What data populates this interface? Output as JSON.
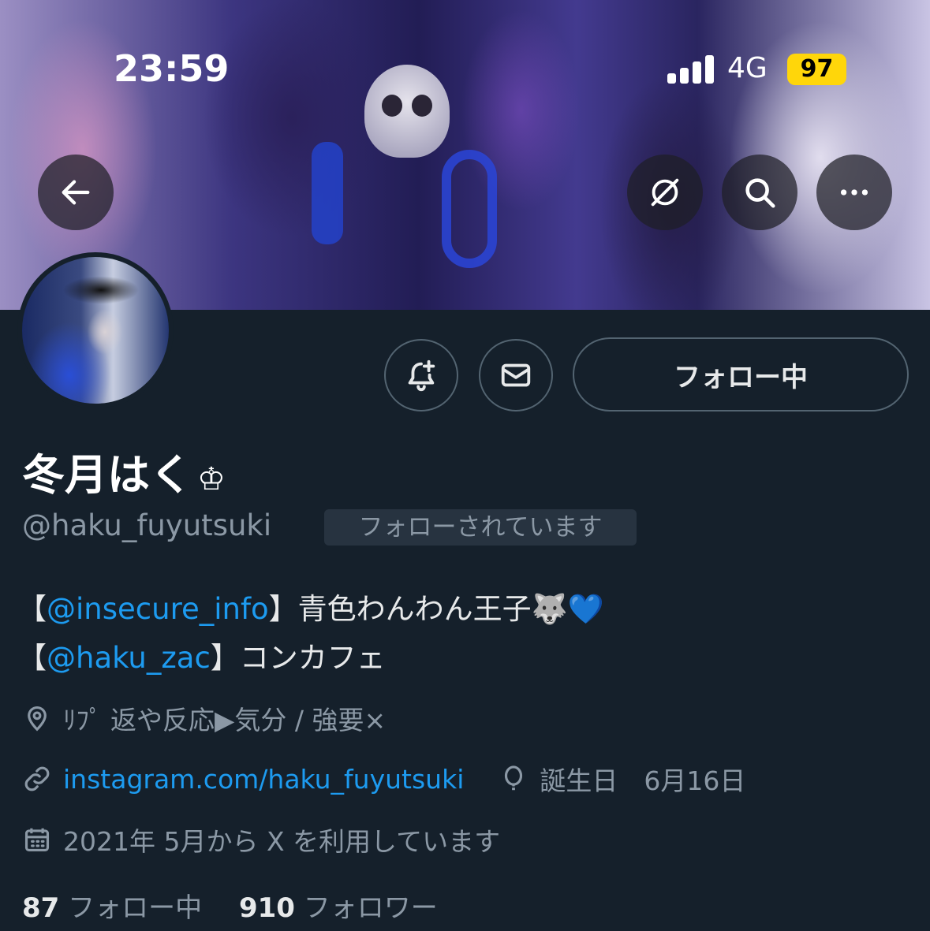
{
  "status_bar": {
    "time": "23:59",
    "network": "4G",
    "battery": "97"
  },
  "header": {
    "icons": [
      "back-arrow-icon",
      "no-grok-icon",
      "search-icon",
      "more-icon"
    ]
  },
  "actions": {
    "follow_label": "フォロー中",
    "icons": [
      "notification-bell-plus-icon",
      "mail-icon"
    ]
  },
  "profile": {
    "name": "冬月はく",
    "name_suffix": "♔",
    "handle": "@haku_fuyutsuki",
    "follows_you": "フォローされています"
  },
  "bio": {
    "line1": {
      "open": "【",
      "mention": "@insecure_info",
      "close": "】",
      "text": "青色わんわん王子🐺💙"
    },
    "line2": {
      "open": "【",
      "mention": "@haku_zac",
      "close": "】",
      "text": "コンカフェ"
    }
  },
  "meta": {
    "location": "ﾘﾌﾟ 返や反応▶︎気分 / 強要×",
    "website": "instagram.com/haku_fuyutsuki",
    "birthday": "誕生日　6月16日",
    "joined": "2021年 5月から X を利用しています"
  },
  "stats": {
    "following_count": "87",
    "following_label": "フォロー中",
    "followers_count": "910",
    "followers_label": "フォロワー"
  },
  "colors": {
    "background": "#15202b",
    "link": "#1d9bf0",
    "muted": "#8b98a5",
    "battery": "#ffd60a"
  }
}
